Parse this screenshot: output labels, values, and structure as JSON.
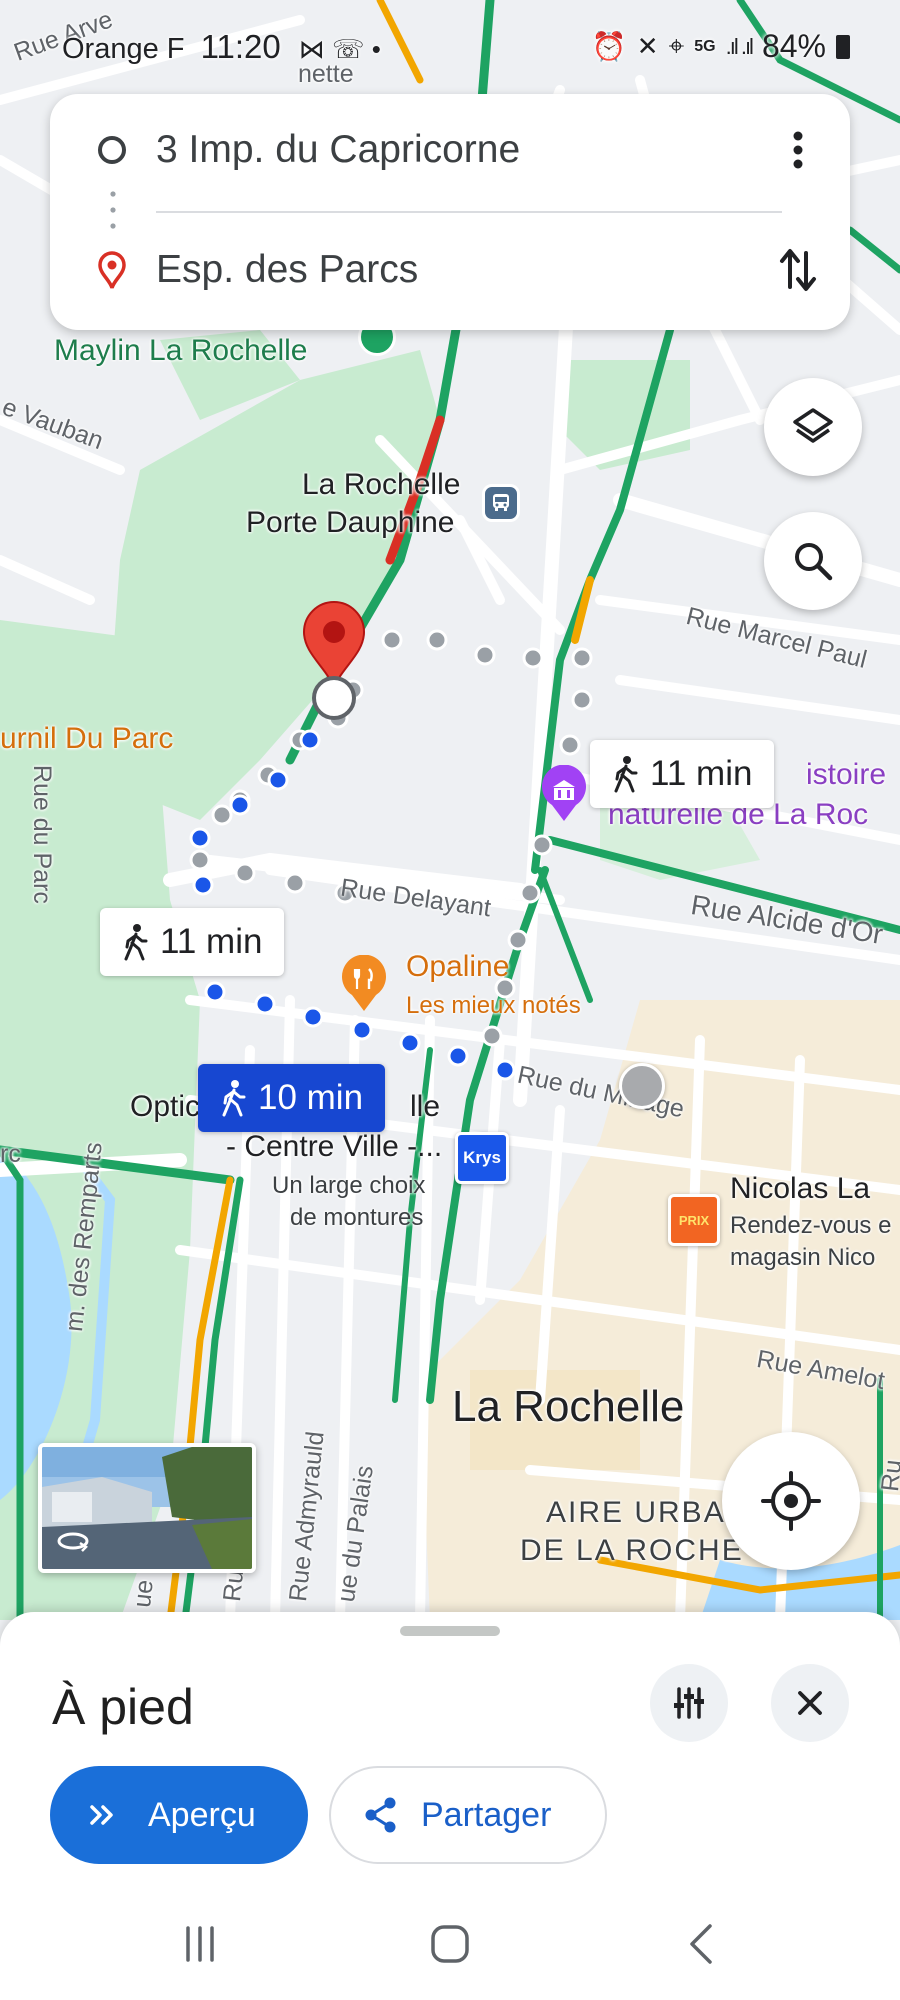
{
  "status_bar": {
    "carrier": "Orange F",
    "time": "11:20",
    "battery": "84%",
    "network": "5G"
  },
  "directions": {
    "origin": "3 Imp. du Capricorne",
    "destination": "Esp. des Parcs",
    "origin_icon": "circle-outline-icon",
    "destination_icon": "location-pin-icon",
    "more_icon": "more-vert-icon",
    "swap_icon": "swap-vert-icon"
  },
  "map_labels": {
    "top_street": "Rue Arve",
    "partial_top": "nette",
    "maylin": "Maylin La Rochelle",
    "vauban": "e Vauban",
    "porte_dauphine_1": "La Rochelle",
    "porte_dauphine_2": "Porte Dauphine",
    "marcel_paul": "Rue Marcel Paul",
    "fournil": "urnil Du Parc",
    "rue_du_parc": "Rue du Parc",
    "museum_1": "istoire",
    "museum_2": "naturelle de La Roc",
    "delayant": "Rue Delayant",
    "alcide": "Rue Alcide d'Or",
    "opaline": "Opaline",
    "opaline_sub": "Les mieux notés",
    "minage": "Rue du Minage",
    "optic_1a": "Optic",
    "optic_1b": "lle",
    "optic_2": "- Centre Ville -...",
    "optic_3": "Un large choix",
    "optic_4": "de montures",
    "krys": "Krys",
    "nicolas_1": "Nicolas La",
    "nicolas_2": "Rendez-vous e",
    "nicolas_3": "magasin Nico",
    "nicolas_logo": "PRIX",
    "remparts": "m. des Remparts",
    "amelot": "Rue Amelot",
    "city": "La Rochelle",
    "area_1": "AIRE URBA",
    "area_2": "DE LA ROCHE",
    "palais": "ue du Palais",
    "admyrauld": "Rue Admyrauld",
    "rc": "rc",
    "ru": "Ru",
    "ue": "ue",
    "right_edge": "Ru"
  },
  "routes": {
    "selected": "10 min",
    "alt_1": "11 min",
    "alt_2": "11 min",
    "mode_icon": "walking-person-icon"
  },
  "map_controls": {
    "layers_icon": "layers-icon",
    "search_icon": "search-icon",
    "location_icon": "my-location-icon",
    "street_view_icon": "street-view-rotate-icon"
  },
  "bottom_sheet": {
    "title": "À pied",
    "options_icon": "tune-icon",
    "close_icon": "close-icon",
    "apercu_label": "Aperçu",
    "partager_label": "Partager"
  },
  "colors": {
    "route_selected": "#1a56e8",
    "route_alternative": "#9aa0a6",
    "traffic_green": "#1ea362",
    "traffic_red": "#d93025",
    "traffic_orange": "#f2a600",
    "park": "#c8ebd0",
    "water": "#aadaff",
    "accent_blue": "#1a6fd9"
  }
}
